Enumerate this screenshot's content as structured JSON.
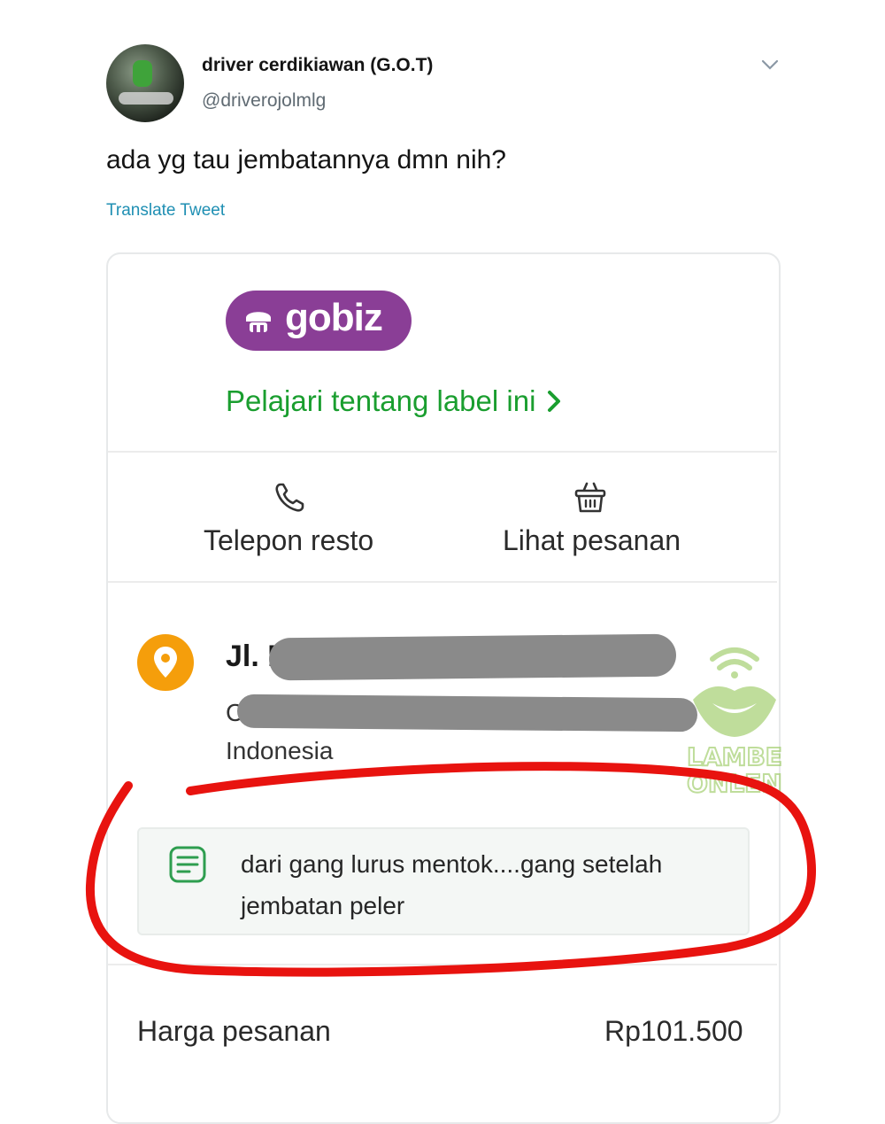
{
  "tweet": {
    "author_name": "driver cerdikiawan (G.O.T)",
    "author_handle": "@driverojolmlg",
    "text": "ada yg tau jembatannya dmn nih?",
    "translate_label": "Translate Tweet"
  },
  "card": {
    "brand": "gobiz",
    "learn_link": "Pelajari tentang label ini",
    "actions": {
      "call": "Telepon resto",
      "view_order": "Lihat pesanan"
    },
    "address": {
      "line1": "Jl. B",
      "line2": "C",
      "line3": "Indonesia"
    },
    "note": "dari gang lurus mentok....gang setelah jembatan peler",
    "price_label": "Harga pesanan",
    "price_value": "Rp101.500"
  },
  "watermark": {
    "line1": "LAMBE",
    "line2": "ONLEN"
  },
  "colors": {
    "gobiz_purple": "#8a3e96",
    "link_green": "#1a9e2f",
    "pin_orange": "#f59e0b",
    "annotation_red": "#e8130f",
    "twitter_blue": "#1f8fb3"
  },
  "icons": [
    "chevron-down-icon",
    "gobiz-logo-icon",
    "chevron-right-icon",
    "phone-icon",
    "basket-icon",
    "location-pin-icon",
    "note-icon"
  ]
}
